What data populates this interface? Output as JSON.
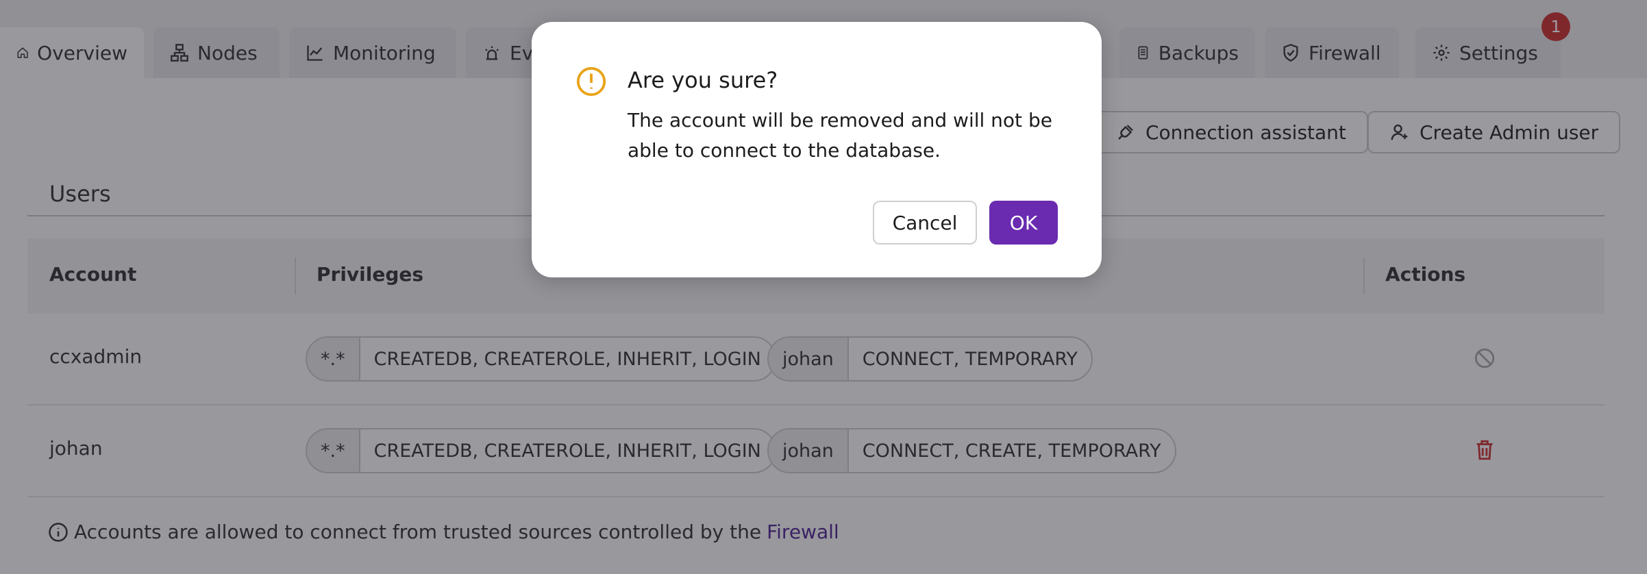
{
  "tabs": [
    {
      "label": "Overview",
      "icon": "home-icon"
    },
    {
      "label": "Nodes",
      "icon": "nodes-icon"
    },
    {
      "label": "Monitoring",
      "icon": "chart-line-icon"
    },
    {
      "label": "Events",
      "icon": "alarm-icon"
    },
    {
      "label": "Backups",
      "icon": "document-icon"
    },
    {
      "label": "Firewall",
      "icon": "shield-check-icon"
    },
    {
      "label": "Settings",
      "icon": "gear-icon"
    }
  ],
  "notification_count": "1",
  "toolbar": {
    "connection_assistant": "Connection assistant",
    "create_admin_user": "Create Admin user"
  },
  "users": {
    "title": "Users",
    "columns": {
      "account": "Account",
      "privileges": "Privileges",
      "actions": "Actions"
    },
    "rows": [
      {
        "account": "ccxadmin",
        "privileges": [
          {
            "scope": "*.*",
            "privs": "CREATEDB, CREATEROLE, INHERIT, LOGIN"
          },
          {
            "scope": "johan",
            "privs": "CONNECT, TEMPORARY"
          }
        ],
        "action": "disabled-icon"
      },
      {
        "account": "johan",
        "privileges": [
          {
            "scope": "*.*",
            "privs": "CREATEDB, CREATEROLE, INHERIT, LOGIN"
          },
          {
            "scope": "johan",
            "privs": "CONNECT, CREATE, TEMPORARY"
          }
        ],
        "action": "trash-icon"
      }
    ],
    "note_text": "Accounts are allowed to connect from trusted sources controlled by the",
    "note_link": "Firewall"
  },
  "modal": {
    "title": "Are you sure?",
    "body": "The account will be removed and will not be able to connect to the database.",
    "cancel": "Cancel",
    "ok": "OK"
  },
  "colors": {
    "primary": "#6a2bb0",
    "warning": "#e8a317",
    "danger": "#c62828",
    "link": "#4a1c8c"
  }
}
